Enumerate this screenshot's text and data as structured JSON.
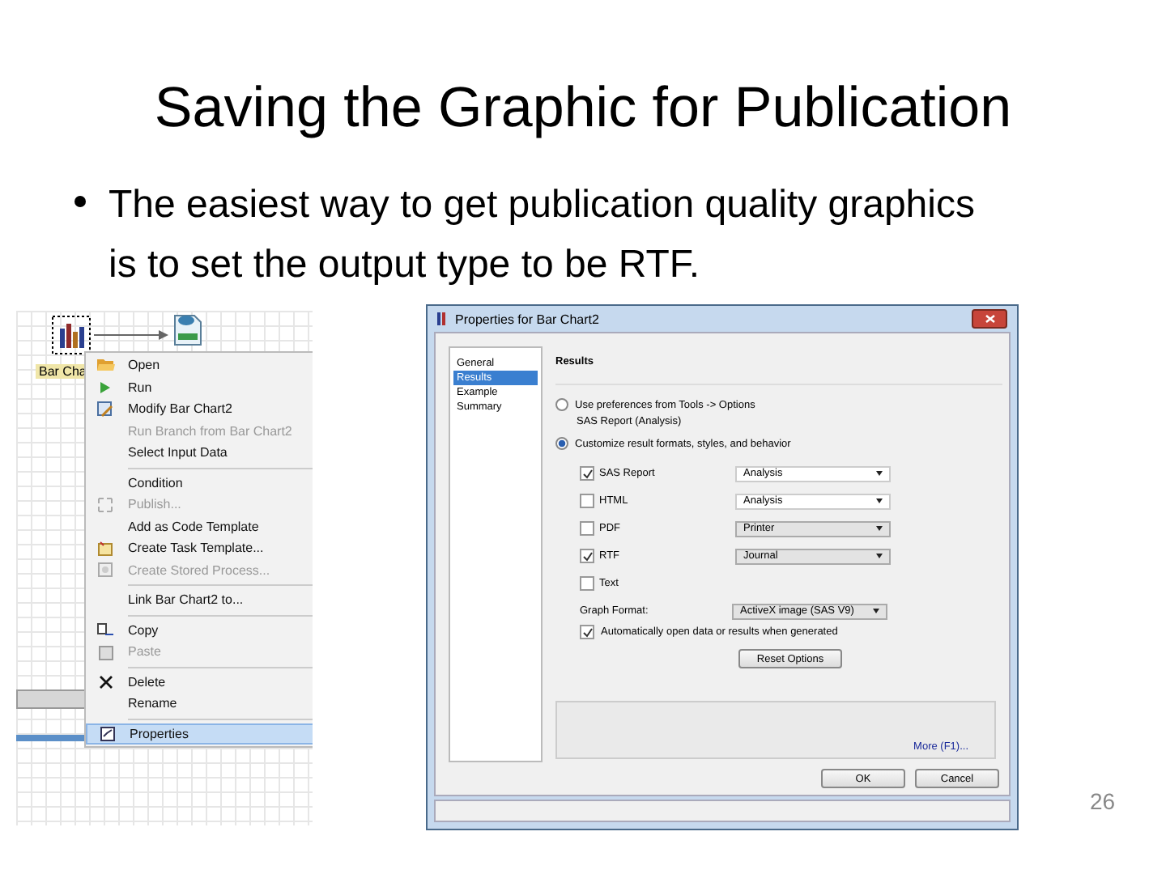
{
  "slide": {
    "title": "Saving the Graphic for Publication",
    "bullets": [
      "The easiest way to get publication quality graphics is to set the output type to be RTF."
    ],
    "page_number": "26"
  },
  "canvas": {
    "node_label": "Bar Cha"
  },
  "context_menu": {
    "groups": [
      [
        {
          "label": "Open",
          "kind": "folder",
          "disabled": false,
          "selected": false
        },
        {
          "label": "Run",
          "kind": "run",
          "disabled": false,
          "selected": false
        },
        {
          "label": "Modify Bar Chart2",
          "kind": "modify",
          "disabled": false,
          "selected": false
        },
        {
          "label": "Run Branch from Bar Chart2",
          "kind": "plain",
          "disabled": true,
          "selected": false
        },
        {
          "label": "Select Input Data",
          "kind": "plain",
          "disabled": false,
          "selected": false
        }
      ],
      [
        {
          "label": "Condition",
          "kind": "plain",
          "disabled": false,
          "selected": false
        },
        {
          "label": "Publish...",
          "kind": "publish",
          "disabled": true,
          "selected": false
        },
        {
          "label": "Add as Code Template",
          "kind": "plain",
          "disabled": false,
          "selected": false
        },
        {
          "label": "Create Task Template...",
          "kind": "template",
          "disabled": false,
          "selected": false
        },
        {
          "label": "Create Stored Process...",
          "kind": "stored",
          "disabled": true,
          "selected": false
        }
      ],
      [
        {
          "label": "Link Bar Chart2 to...",
          "kind": "plain",
          "disabled": false,
          "selected": false
        }
      ],
      [
        {
          "label": "Copy",
          "kind": "copy",
          "disabled": false,
          "selected": false
        },
        {
          "label": "Paste",
          "kind": "paste",
          "disabled": true,
          "selected": false
        }
      ],
      [
        {
          "label": "Delete",
          "kind": "delete",
          "disabled": false,
          "selected": false
        },
        {
          "label": "Rename",
          "kind": "plain",
          "disabled": false,
          "selected": false
        }
      ],
      [
        {
          "label": "Properties",
          "kind": "properties",
          "disabled": false,
          "selected": true
        }
      ]
    ]
  },
  "dialog": {
    "title": "Properties for Bar Chart2",
    "nav": [
      {
        "label": "General",
        "selected": false
      },
      {
        "label": "Results",
        "selected": true
      },
      {
        "label": "Example",
        "selected": false
      },
      {
        "label": "Summary",
        "selected": false
      }
    ],
    "heading": "Results",
    "radios": [
      {
        "label": "Use preferences from Tools -> Options",
        "note": "SAS Report (Analysis)",
        "selected": false
      },
      {
        "label": "Customize result formats, styles, and behavior",
        "selected": true
      }
    ],
    "formats": [
      {
        "label": "SAS Report",
        "checked": true,
        "dropdown": "Analysis",
        "dropdown_disabled": false
      },
      {
        "label": "HTML",
        "checked": false,
        "dropdown": "Analysis",
        "dropdown_disabled": false
      },
      {
        "label": "PDF",
        "checked": false,
        "dropdown": "Printer",
        "dropdown_disabled": true
      },
      {
        "label": "RTF",
        "checked": true,
        "dropdown": "Journal",
        "dropdown_disabled": true
      },
      {
        "label": "Text",
        "checked": false
      }
    ],
    "graph_format": {
      "label": "Graph Format:",
      "value": "ActiveX image (SAS V9)"
    },
    "auto_open": {
      "label": "Automatically open data or results when generated",
      "checked": true
    },
    "reset_button": "Reset Options",
    "help_link": "More (F1)...",
    "buttons": [
      "OK",
      "Cancel"
    ]
  }
}
